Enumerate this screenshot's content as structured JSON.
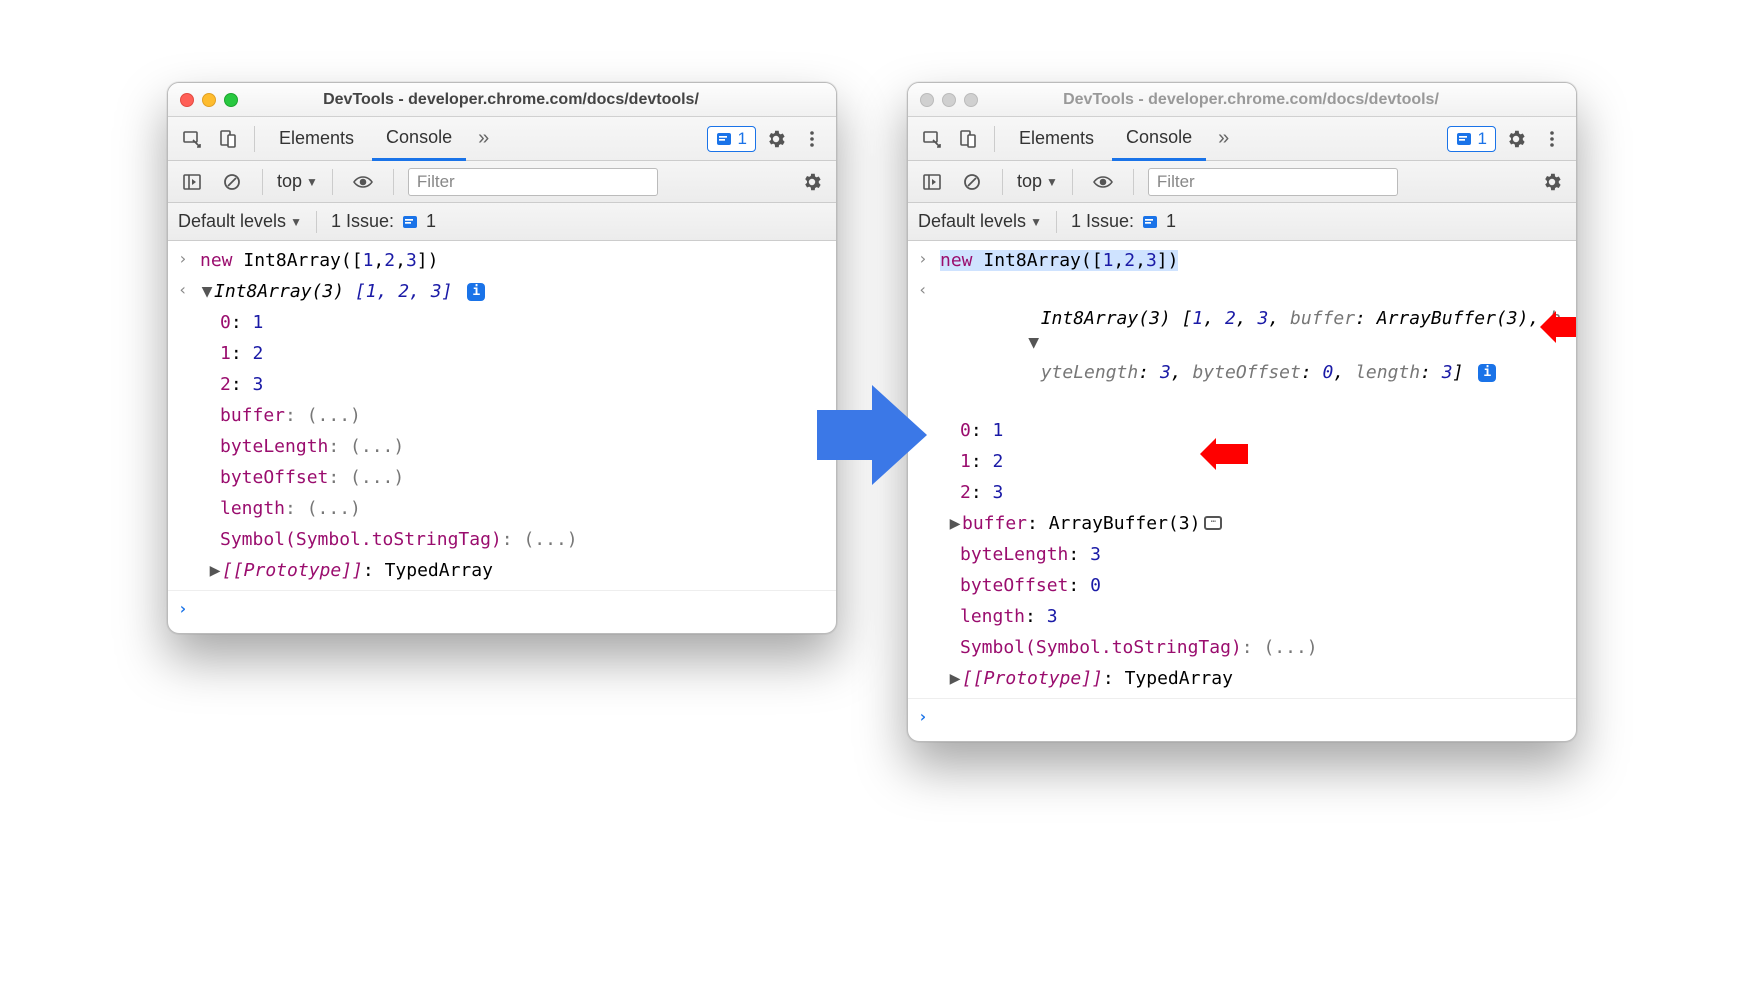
{
  "title": "DevTools - developer.chrome.com/docs/devtools/",
  "tabs": {
    "elements": "Elements",
    "console": "Console"
  },
  "context": "top",
  "filter_placeholder": "Filter",
  "levels": "Default levels",
  "issues_label": "1 Issue:",
  "issues_count": "1",
  "pill_count": "1",
  "input_code": "new Int8Array([1,2,3])",
  "left": {
    "summary_head": "Int8Array(3)",
    "summary_arr": "[1, 2, 3]",
    "entries": [
      {
        "k": "0",
        "v": "1"
      },
      {
        "k": "1",
        "v": "2"
      },
      {
        "k": "2",
        "v": "3"
      }
    ],
    "lazy": [
      "buffer",
      "byteLength",
      "byteOffset",
      "length",
      "Symbol(Symbol.toStringTag)"
    ],
    "proto_key": "[[Prototype]]",
    "proto_val": "TypedArray"
  },
  "right": {
    "summary_line1": "Int8Array(3) [1, 2, 3, buffer: ArrayBuffer(3), b",
    "summary_line2": "yteLength: 3, byteOffset: 0, length: 3]",
    "entries": [
      {
        "k": "0",
        "v": "1"
      },
      {
        "k": "1",
        "v": "2"
      },
      {
        "k": "2",
        "v": "3"
      }
    ],
    "buffer_key": "buffer",
    "buffer_val": "ArrayBuffer(3)",
    "props": [
      {
        "k": "byteLength",
        "v": "3"
      },
      {
        "k": "byteOffset",
        "v": "0"
      },
      {
        "k": "length",
        "v": "3"
      }
    ],
    "symprop": "Symbol(Symbol.toStringTag)",
    "proto_key": "[[Prototype]]",
    "proto_val": "TypedArray"
  }
}
